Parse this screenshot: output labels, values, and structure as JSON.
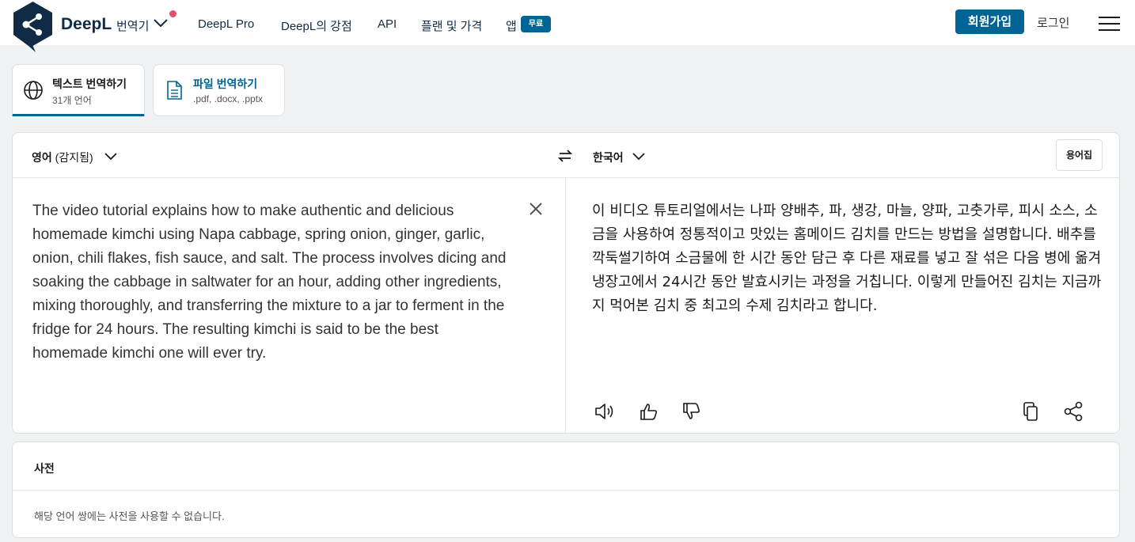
{
  "header": {
    "brand": "DeepL",
    "product": "번역기",
    "nav": [
      {
        "label": "DeepL Pro"
      },
      {
        "label": "DeepL의 강점"
      },
      {
        "label": "API"
      },
      {
        "label": "플랜 및 가격"
      },
      {
        "label": "앱"
      }
    ],
    "free_badge": "무료",
    "signup": "회원가입",
    "login": "로그인",
    "icons": [
      "deepl-logo",
      "chevron-down-icon",
      "notification-dot",
      "hamburger-menu-icon"
    ]
  },
  "tabs": [
    {
      "title": "텍스트 번역하기",
      "sub": "31개 언어",
      "icon": "globe-icon",
      "active": true
    },
    {
      "title": "파일 번역하기",
      "sub": ".pdf, .docx, .pptx",
      "icon": "document-icon",
      "active": false
    }
  ],
  "translator": {
    "source_lang": "영어",
    "source_detected": "(감지됨)",
    "target_lang": "한국어",
    "glossary": "용어집",
    "source_text": "The video tutorial explains how to make authentic and delicious homemade kimchi using Napa cabbage, spring onion, ginger, garlic, onion, chili flakes, fish sauce, and salt. The process involves dicing and soaking the cabbage in saltwater for an hour, adding other ingredients, mixing thoroughly, and transferring the mixture to a jar to ferment in the fridge for 24 hours. The resulting kimchi is said to be the best homemade kimchi one will ever try.",
    "target_text": "이 비디오 튜토리얼에서는 나파 양배추, 파, 생강, 마늘, 양파, 고춧가루, 피시 소스, 소금을 사용하여 정통적이고 맛있는 홈메이드 김치를 만드는 방법을 설명합니다. 배추를 깍둑썰기하여 소금물에 한 시간 동안 담근 후 다른 재료를 넣고 잘 섞은 다음 병에 옮겨 냉장고에서 24시간 동안 발효시키는 과정을 거칩니다. 이렇게 만들어진 김치는 지금까지 먹어본 김치 중 최고의 수제 김치라고 합니다.",
    "icons": [
      "swap-languages-icon",
      "clear-icon",
      "speaker-icon",
      "thumbs-up-icon",
      "thumbs-down-icon",
      "copy-icon",
      "share-icon"
    ]
  },
  "dictionary": {
    "title": "사전",
    "empty_message": "해당 언어 쌍에는 사전을 사용할 수 없습니다."
  },
  "colors": {
    "brand_navy": "#0f2b46",
    "accent_blue": "#006494",
    "notification_red": "#e0516b",
    "page_bg": "#f1f2f3"
  }
}
